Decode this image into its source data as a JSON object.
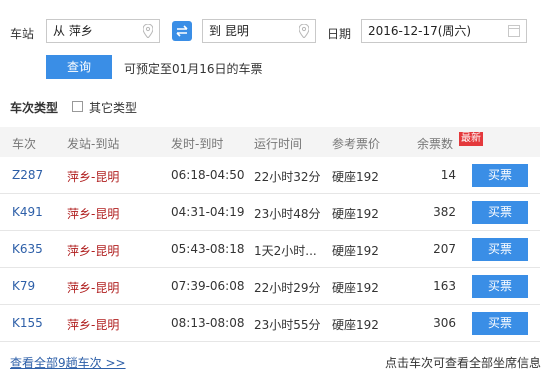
{
  "search": {
    "station_label": "车站",
    "from_value": "从 萍乡",
    "to_value": "到 昆明",
    "date_label": "日期",
    "date_value": "2016-12-17(周六)",
    "query_label": "查询",
    "presale_note": "可预定至01月16日的车票"
  },
  "filter": {
    "type_label": "车次类型",
    "other_type": "其它类型"
  },
  "table": {
    "headers": {
      "train": "车次",
      "route": "发站-到站",
      "time": "发时-到时",
      "duration": "运行时间",
      "price": "参考票价",
      "remaining": "余票数",
      "new_badge": "最新"
    },
    "rows": [
      {
        "train": "Z287",
        "route": "萍乡-昆明",
        "time": "06:18-04:50",
        "duration": "22小时32分",
        "price": "硬座192",
        "remaining": "14",
        "buy": "买票"
      },
      {
        "train": "K491",
        "route": "萍乡-昆明",
        "time": "04:31-04:19",
        "duration": "23小时48分",
        "price": "硬座192",
        "remaining": "382",
        "buy": "买票"
      },
      {
        "train": "K635",
        "route": "萍乡-昆明",
        "time": "05:43-08:18",
        "duration": "1天2小时...",
        "price": "硬座192",
        "remaining": "207",
        "buy": "买票"
      },
      {
        "train": "K79",
        "route": "萍乡-昆明",
        "time": "07:39-06:08",
        "duration": "22小时29分",
        "price": "硬座192",
        "remaining": "163",
        "buy": "买票"
      },
      {
        "train": "K155",
        "route": "萍乡-昆明",
        "time": "08:13-08:08",
        "duration": "23小时55分",
        "price": "硬座192",
        "remaining": "306",
        "buy": "买票"
      }
    ]
  },
  "footer": {
    "all_link": "查看全部9趟车次 >>",
    "hint": "点击车次可查看全部坐席信息"
  },
  "colors": {
    "accent": "#3a8ee6",
    "route": "#b01f1f",
    "train_link": "#2d5fa8",
    "badge": "#e4393c"
  },
  "icons": [
    "location-pin-icon",
    "swap-icon",
    "calendar-icon",
    "checkbox-icon"
  ]
}
